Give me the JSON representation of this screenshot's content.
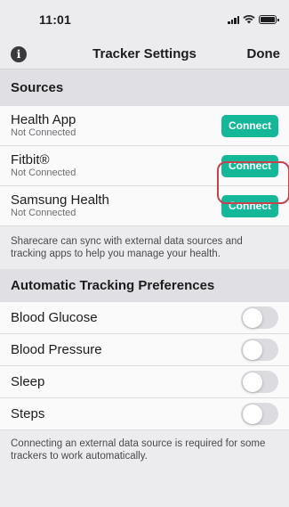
{
  "status_bar": {
    "time": "11:01"
  },
  "nav": {
    "title": "Tracker Settings",
    "done_label": "Done"
  },
  "sources": {
    "header": "Sources",
    "items": [
      {
        "name": "Health App",
        "status": "Not Connected",
        "button": "Connect"
      },
      {
        "name": "Fitbit®",
        "status": "Not Connected",
        "button": "Connect"
      },
      {
        "name": "Samsung Health",
        "status": "Not Connected",
        "button": "Connect"
      }
    ],
    "footnote": "Sharecare can sync with external data sources and tracking apps to help you manage your health."
  },
  "preferences": {
    "header": "Automatic Tracking Preferences",
    "items": [
      {
        "label": "Blood Glucose",
        "enabled": false
      },
      {
        "label": "Blood Pressure",
        "enabled": false
      },
      {
        "label": "Sleep",
        "enabled": false
      },
      {
        "label": "Steps",
        "enabled": false
      }
    ],
    "footnote": "Connecting an external data source is required for some trackers to work automatically."
  },
  "colors": {
    "connect_button": "#14b898",
    "highlight_ring": "#c9414b",
    "toggle_off": "#dcdce0"
  }
}
